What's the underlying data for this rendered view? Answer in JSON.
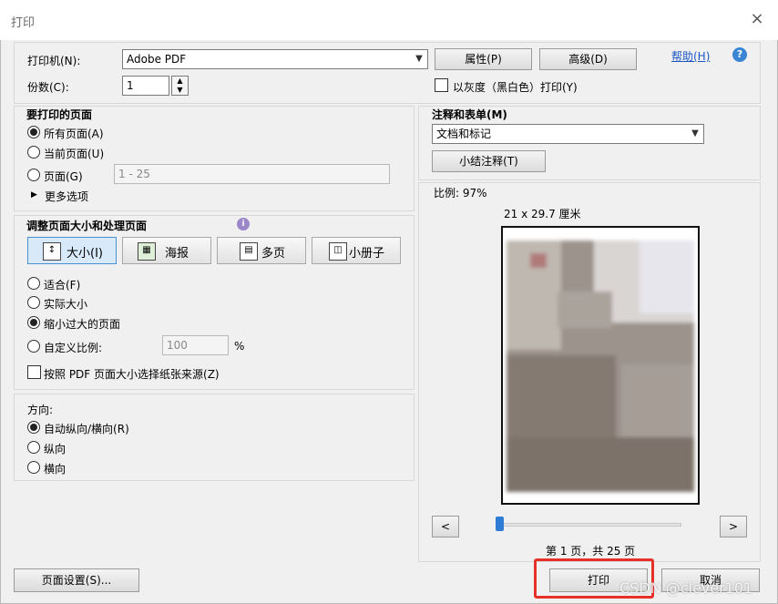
{
  "window": {
    "title": "打印",
    "close_glyph": "×"
  },
  "printer": {
    "label": "打印机(N):",
    "value": "Adobe PDF",
    "properties_button": "属性(P)",
    "advanced_button": "高级(D)",
    "help_link": "帮助(H)",
    "help_icon": "?"
  },
  "copies": {
    "label": "份数(C):",
    "value": "1"
  },
  "grayscale": {
    "label": "以灰度（黑白色）打印(Y)",
    "checked": false
  },
  "pages_to_print": {
    "heading": "要打印的页面",
    "options": [
      {
        "label": "所有页面(A)",
        "selected": true
      },
      {
        "label": "当前页面(U)",
        "selected": false
      },
      {
        "label": "页面(G)",
        "selected": false
      }
    ],
    "range_placeholder": "1 - 25",
    "more_options": "更多选项"
  },
  "sizing": {
    "heading": "调整页面大小和处理页面",
    "info_icon": "i",
    "tabs": [
      {
        "label": "大小(I)",
        "icon": "size-icon",
        "active": true
      },
      {
        "label": "海报",
        "icon": "poster-icon",
        "active": false
      },
      {
        "label": "多页",
        "icon": "multiple-pages-icon",
        "active": false
      },
      {
        "label": "小册子",
        "icon": "booklet-icon",
        "active": false
      }
    ],
    "options": [
      {
        "label": "适合(F)",
        "selected": false
      },
      {
        "label": "实际大小",
        "selected": false
      },
      {
        "label": "缩小过大的页面",
        "selected": true
      },
      {
        "label": "自定义比例:",
        "selected": false
      }
    ],
    "custom_scale_value": "100",
    "percent": "%",
    "paper_source_label": "按照 PDF 页面大小选择纸张来源(Z)"
  },
  "orientation": {
    "heading": "方向:",
    "options": [
      {
        "label": "自动纵向/横向(R)",
        "selected": true
      },
      {
        "label": "纵向",
        "selected": false
      },
      {
        "label": "横向",
        "selected": false
      }
    ]
  },
  "comments": {
    "heading": "注释和表单(M)",
    "value": "文档和标记",
    "summarize_button": "小结注释(T)"
  },
  "preview": {
    "scale_label": "比例:   97%",
    "paper_size": "21 x 29.7 厘米",
    "prev_glyph": "<",
    "next_glyph": ">",
    "slider_fraction": 0.0,
    "page_indicator": "第 1 页，共 25 页"
  },
  "footer": {
    "page_setup_button": "页面设置(S)...",
    "print_button": "打印",
    "cancel_button": "取消",
    "watermark": "CSDN @clever101"
  },
  "colors": {
    "highlight": "#e8302a",
    "accent": "#2e7cd6"
  }
}
